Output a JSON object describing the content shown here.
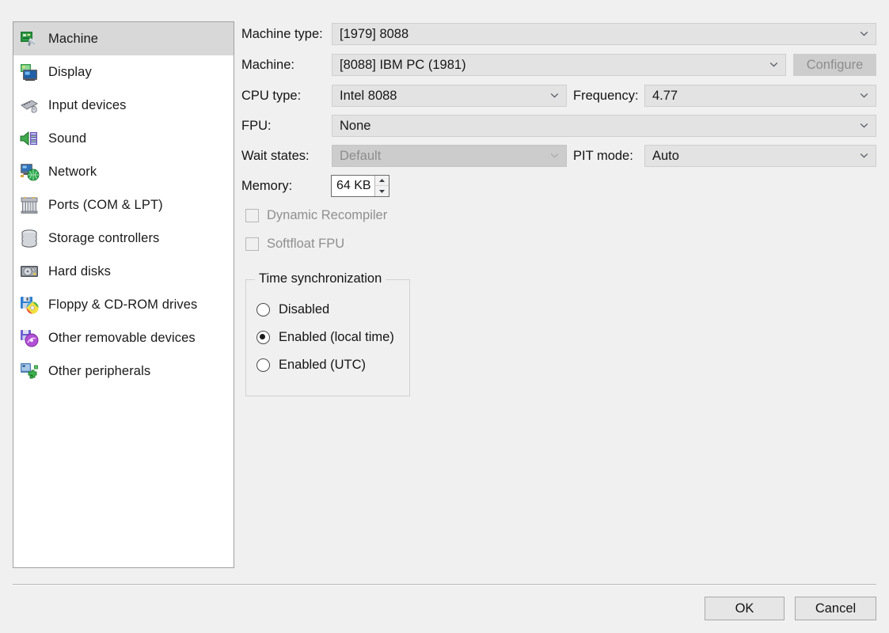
{
  "sidebar": {
    "items": [
      {
        "label": "Machine",
        "icon": "machine-icon",
        "selected": true
      },
      {
        "label": "Display",
        "icon": "display-icon",
        "selected": false
      },
      {
        "label": "Input devices",
        "icon": "input-devices-icon",
        "selected": false
      },
      {
        "label": "Sound",
        "icon": "sound-icon",
        "selected": false
      },
      {
        "label": "Network",
        "icon": "network-icon",
        "selected": false
      },
      {
        "label": "Ports (COM & LPT)",
        "icon": "ports-icon",
        "selected": false
      },
      {
        "label": "Storage controllers",
        "icon": "storage-controllers-icon",
        "selected": false
      },
      {
        "label": "Hard disks",
        "icon": "hard-disks-icon",
        "selected": false
      },
      {
        "label": "Floppy & CD-ROM drives",
        "icon": "floppy-cdrom-icon",
        "selected": false
      },
      {
        "label": "Other removable devices",
        "icon": "other-removable-devices-icon",
        "selected": false
      },
      {
        "label": "Other peripherals",
        "icon": "other-peripherals-icon",
        "selected": false
      }
    ]
  },
  "form": {
    "machine_type": {
      "label": "Machine type:",
      "value": "[1979] 8088",
      "enabled": true
    },
    "machine": {
      "label": "Machine:",
      "value": "[8088] IBM PC (1981)",
      "enabled": true
    },
    "configure": {
      "label": "Configure",
      "enabled": false
    },
    "cpu_type": {
      "label": "CPU type:",
      "value": "Intel 8088",
      "enabled": true
    },
    "frequency": {
      "label": "Frequency:",
      "value": "4.77",
      "enabled": true
    },
    "fpu": {
      "label": "FPU:",
      "value": "None",
      "enabled": true
    },
    "wait_states": {
      "label": "Wait states:",
      "value": "Default",
      "enabled": false
    },
    "pit_mode": {
      "label": "PIT mode:",
      "value": "Auto",
      "enabled": true
    },
    "memory": {
      "label": "Memory:",
      "value": "64 KB",
      "enabled": true
    },
    "dynamic_recompiler": {
      "label": "Dynamic Recompiler",
      "checked": false,
      "enabled": false
    },
    "softfloat_fpu": {
      "label": "Softfloat FPU",
      "checked": false,
      "enabled": false
    }
  },
  "time_sync": {
    "title": "Time synchronization",
    "options": [
      {
        "label": "Disabled",
        "selected": false
      },
      {
        "label": "Enabled (local time)",
        "selected": true
      },
      {
        "label": "Enabled (UTC)",
        "selected": false
      }
    ]
  },
  "footer": {
    "ok_label": "OK",
    "cancel_label": "Cancel"
  },
  "colors": {
    "window_background": "#f0f0f0",
    "list_background": "#ffffff",
    "selection": "#d8d8d8",
    "field_background": "#e3e3e3",
    "field_disabled": "#cccccc",
    "text": "#141414",
    "text_disabled": "#8f8f8f"
  }
}
